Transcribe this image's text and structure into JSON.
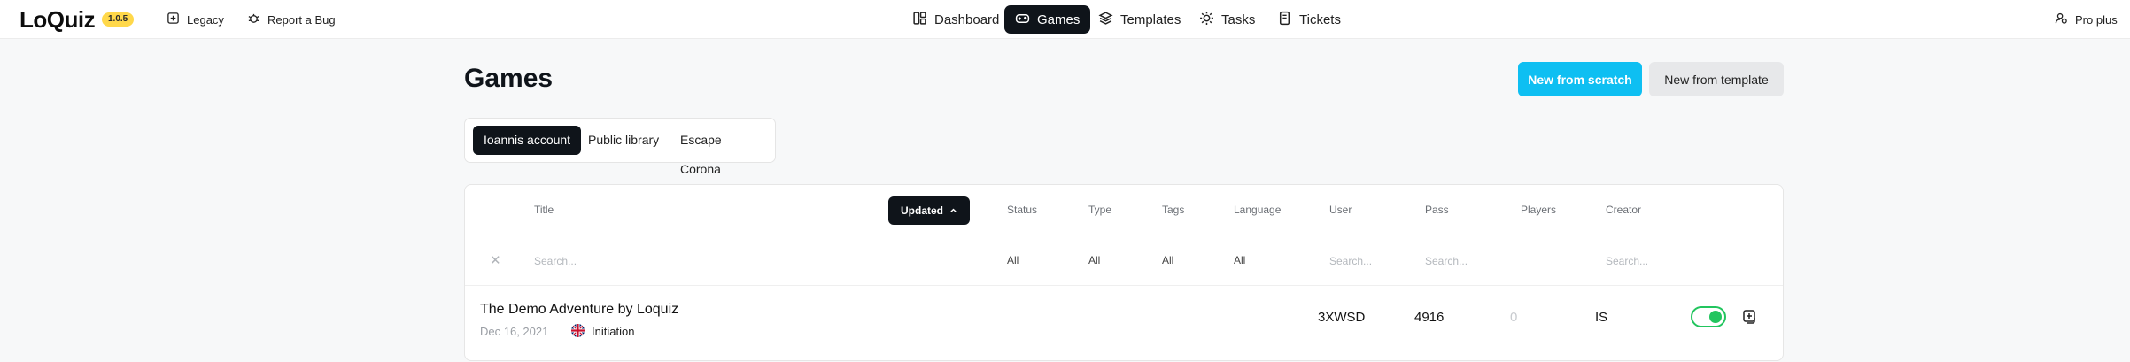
{
  "app": {
    "logo": "LoQuiz",
    "version": "1.0.5",
    "links": [
      {
        "label": "Legacy",
        "icon": "plus-square-icon"
      },
      {
        "label": "Report a Bug",
        "icon": "bug-icon"
      }
    ],
    "account_label": "Pro plus"
  },
  "nav": [
    {
      "label": "Dashboard",
      "icon": "dashboard-icon",
      "active": false
    },
    {
      "label": "Games",
      "icon": "gamepad-icon",
      "active": true
    },
    {
      "label": "Templates",
      "icon": "layers-icon",
      "active": false
    },
    {
      "label": "Tasks",
      "icon": "bug-sun-icon",
      "active": false
    },
    {
      "label": "Tickets",
      "icon": "ticket-icon",
      "active": false
    }
  ],
  "page": {
    "title": "Games",
    "new_scratch": "New from scratch",
    "new_template": "New from template"
  },
  "account_tabs": [
    {
      "label": "Ioannis account",
      "active": true
    },
    {
      "label": "Public library",
      "active": false
    },
    {
      "label": "Escape Corona",
      "active": false
    }
  ],
  "table": {
    "columns": {
      "title": "Title",
      "sort": "Updated",
      "status": "Status",
      "type": "Type",
      "tags": "Tags",
      "language": "Language",
      "user": "User",
      "pass": "Pass",
      "players": "Players",
      "creator": "Creator"
    },
    "filters": {
      "title_placeholder": "Search...",
      "status": "All",
      "type": "All",
      "tags": "All",
      "language": "All",
      "user_placeholder": "Search...",
      "pass_placeholder": "Search...",
      "creator_placeholder": "Search..."
    },
    "rows": [
      {
        "title": "The Demo Adventure by Loquiz",
        "date": "Dec 16, 2021",
        "type": "Initiation",
        "user": "3XWSD",
        "pass": "4916",
        "players": "0",
        "creator": "IS",
        "active": true
      }
    ]
  },
  "colors": {
    "primary": "#0ebff2",
    "dark": "#0f141a",
    "toggle_on": "#22c55e",
    "version_badge": "#ffd84a"
  }
}
